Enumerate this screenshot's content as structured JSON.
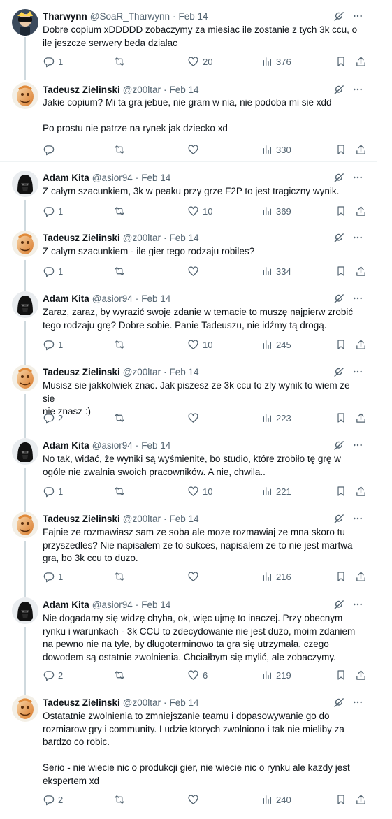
{
  "colors": {
    "text": "#0f1419",
    "muted": "#536471",
    "border": "#eff3f4",
    "thread_line": "#cfd9de"
  },
  "icons": {
    "grok": "grok-icon",
    "more": "more-icon",
    "reply": "reply-icon",
    "retweet": "retweet-icon",
    "like": "like-icon",
    "views": "views-icon",
    "bookmark": "bookmark-icon",
    "share": "share-icon"
  },
  "tweets": [
    {
      "name": "Tharwynn",
      "handle": "@SoaR_Tharwynn",
      "sep": "·",
      "date": "Feb 14",
      "lines": [
        "Dobre copium xDDDDD zobaczymy za miesiac ile zostanie z tych 3k ccu, o",
        "ile jeszcze serwery beda dzialac"
      ],
      "replies": "1",
      "retweets": "",
      "likes": "20",
      "views": "376"
    },
    {
      "name": "Tadeusz Zielinski",
      "handle": "@z00ltar",
      "sep": "·",
      "date": "Feb 14",
      "lines": [
        "Jakie copium? Mi ta gra jebue, nie gram w nia, nie podoba mi sie xdd",
        "",
        "Po prostu nie patrze na rynek jak dziecko xd"
      ],
      "replies": "",
      "retweets": "",
      "likes": "",
      "views": "330"
    },
    {
      "name": "Adam Kita",
      "handle": "@asior94",
      "sep": "·",
      "date": "Feb 14",
      "lines": [
        "Z całym szacunkiem, 3k w peaku przy grze F2P to jest tragiczny wynik."
      ],
      "replies": "1",
      "retweets": "",
      "likes": "10",
      "views": "369"
    },
    {
      "name": "Tadeusz Zielinski",
      "handle": "@z00ltar",
      "sep": "·",
      "date": "Feb 14",
      "lines": [
        "Z calym szacunkiem - ile gier tego rodzaju robiles?"
      ],
      "replies": "1",
      "retweets": "",
      "likes": "",
      "views": "334"
    },
    {
      "name": "Adam Kita",
      "handle": "@asior94",
      "sep": "·",
      "date": "Feb 14",
      "lines": [
        "Zaraz, zaraz, by wyrazić swoje zdanie w temacie to muszę najpierw zrobić",
        "tego rodzaju grę? Dobre sobie. Panie Tadeuszu, nie idźmy tą drogą."
      ],
      "replies": "1",
      "retweets": "",
      "likes": "10",
      "views": "245"
    },
    {
      "name": "Tadeusz Zielinski",
      "handle": "@z00ltar",
      "sep": "·",
      "date": "Feb 14",
      "lines": [
        "Musisz sie jakkolwiek znac. Jak piszesz ze 3k ccu to zly wynik to wiem ze sie",
        "nie znasz :)"
      ],
      "replies": "2",
      "retweets": "",
      "likes": "",
      "views": "223"
    },
    {
      "name": "Adam Kita",
      "handle": "@asior94",
      "sep": "·",
      "date": "Feb 14",
      "lines": [
        "No tak, widać, że wyniki są wyśmienite, bo studio, które zrobiło tę grę w",
        "ogóle nie zwalnia swoich pracowników. A nie, chwila.."
      ],
      "replies": "1",
      "retweets": "",
      "likes": "10",
      "views": "221"
    },
    {
      "name": "Tadeusz Zielinski",
      "handle": "@z00ltar",
      "sep": "·",
      "date": "Feb 14",
      "lines": [
        "Fajnie ze rozmawiasz sam ze soba ale moze rozmawiaj ze mna skoro tu",
        "przyszedles? Nie napisalem ze to sukces, napisalem ze to nie jest martwa",
        "gra, bo 3k ccu to duzo."
      ],
      "replies": "1",
      "retweets": "",
      "likes": "",
      "views": "216"
    },
    {
      "name": "Adam Kita",
      "handle": "@asior94",
      "sep": "·",
      "date": "Feb 14",
      "lines": [
        "Nie dogadamy się widzę chyba, ok, więc ujmę to inaczej. Przy obecnym",
        "rynku i warunkach - 3k CCU to zdecydowanie nie jest dużo, moim zdaniem",
        "na pewno nie na tyle, by długoterminowo ta gra się utrzymała, czego",
        "dowodem są ostatnie zwolnienia. Chciałbym się mylić, ale zobaczymy."
      ],
      "replies": "2",
      "retweets": "",
      "likes": "6",
      "views": "219"
    },
    {
      "name": "Tadeusz Zielinski",
      "handle": "@z00ltar",
      "sep": "·",
      "date": "Feb 14",
      "lines": [
        "Ostatatnie zwolnienia to zmniejszanie teamu i dopasowywanie go do",
        "rozmiarow gry i community. Ludzie ktorych zwolniono i tak nie mieliby za",
        "bardzo co robic.",
        "",
        "Serio - nie wiecie nic o produkcji gier, nie wiecie nic o rynku ale kazdy jest",
        "ekspertem xd"
      ],
      "replies": "2",
      "retweets": "",
      "likes": "",
      "views": "240"
    }
  ]
}
